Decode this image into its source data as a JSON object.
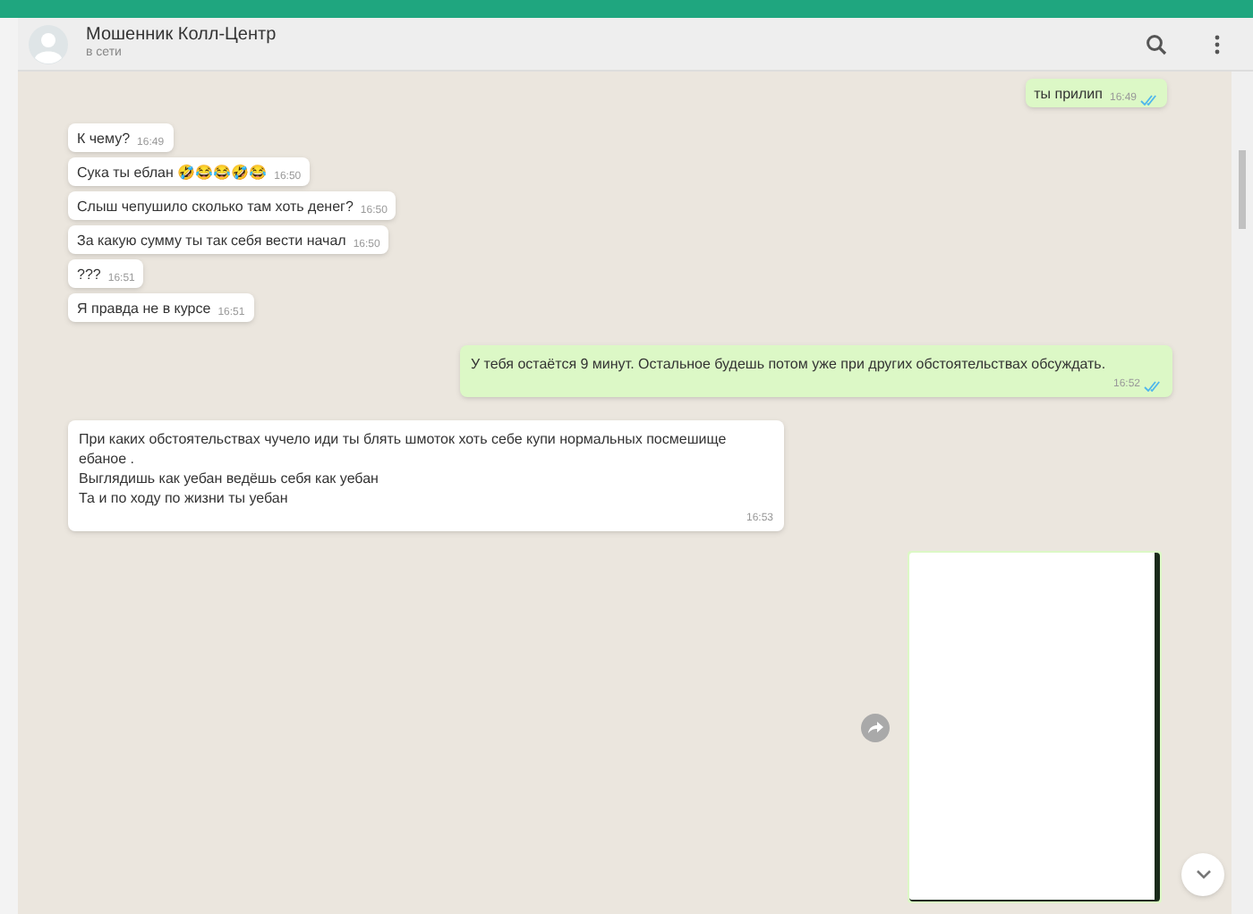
{
  "header": {
    "name": "Мошенник Колл-Центр",
    "status": "в сети"
  },
  "messages": [
    {
      "kind": "text",
      "outgoing": true,
      "text": "ты прилип",
      "time": "16:49",
      "read": true
    },
    {
      "kind": "text",
      "outgoing": false,
      "text": "К чему?",
      "time": "16:49"
    },
    {
      "kind": "text",
      "outgoing": false,
      "text": "Сука ты еблан 🤣😂😂🤣😂",
      "time": "16:50"
    },
    {
      "kind": "text",
      "outgoing": false,
      "text": "Слыш чепушило сколько там хоть денег?",
      "time": "16:50"
    },
    {
      "kind": "text",
      "outgoing": false,
      "text": "За какую сумму ты так себя вести начал",
      "time": "16:50"
    },
    {
      "kind": "text",
      "outgoing": false,
      "text": "???",
      "time": "16:51"
    },
    {
      "kind": "text",
      "outgoing": false,
      "text": "Я правда не в курсе",
      "time": "16:51"
    },
    {
      "kind": "long",
      "outgoing": true,
      "text": "У тебя остаётся 9 минут. Остальное будешь потом уже при других обстоятельствах обсуждать.",
      "time": "16:52",
      "read": true
    },
    {
      "kind": "long",
      "outgoing": false,
      "lines": [
        "При каких обстоятельствах чучело иди ты блять шмоток хоть себе купи нормальных посмешище ебаное .",
        "Выглядишь как уебан ведёшь себя как уебан",
        "Та и по ходу по жизни ты уебан"
      ],
      "time": "16:53"
    },
    {
      "kind": "image",
      "outgoing": true
    }
  ]
}
